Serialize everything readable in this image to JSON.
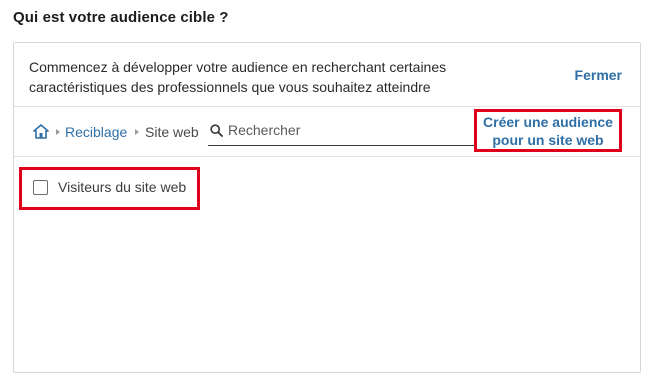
{
  "section_title": "Qui est votre audience cible ?",
  "intro": {
    "text": "Commencez à développer votre audience en recherchant certaines caractéristiques des professionnels que vous souhaitez atteindre",
    "close_label": "Fermer"
  },
  "breadcrumb": {
    "home_icon": "home-icon",
    "items": [
      "Reciblage",
      "Site web"
    ]
  },
  "search": {
    "icon": "search-icon",
    "placeholder": "Rechercher",
    "value": ""
  },
  "create_audience": {
    "line1": "Créer une audience",
    "line2": "pour un site web"
  },
  "options": [
    {
      "label": "Visiteurs du site web",
      "checked": false
    }
  ],
  "colors": {
    "link": "#2f6fa7",
    "highlight": "#e0001b",
    "border": "#d6d6d6"
  }
}
